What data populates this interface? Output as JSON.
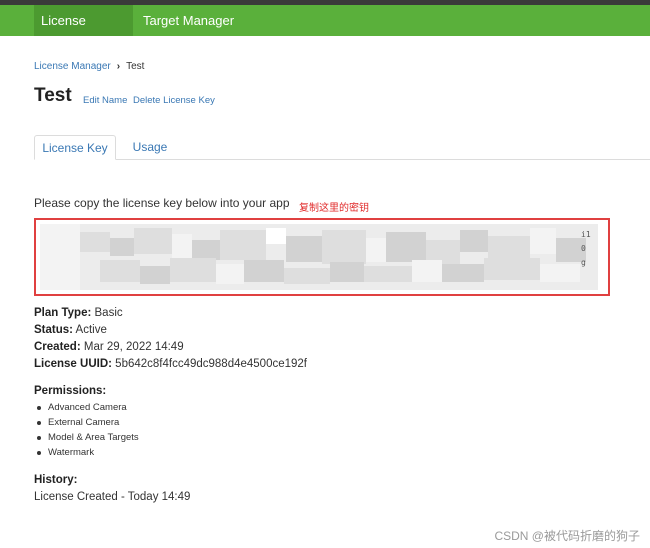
{
  "nav": {
    "items": [
      {
        "label": "License Manager",
        "active": true
      },
      {
        "label": "Target Manager",
        "active": false
      }
    ]
  },
  "breadcrumb": {
    "parent": "License Manager",
    "separator": "›",
    "current": "Test"
  },
  "page": {
    "title": "Test",
    "edit_name": "Edit Name",
    "delete_key": "Delete License Key"
  },
  "tabs": [
    {
      "label": "License Key",
      "active": true
    },
    {
      "label": "Usage",
      "active": false
    }
  ],
  "license": {
    "instructions": "Please copy the license key below into your app",
    "annotation": "复制这里的密钥",
    "key_redacted": true,
    "key_visible_edges": [
      "i1",
      "0",
      "g"
    ]
  },
  "details": {
    "plan_type_label": "Plan Type:",
    "plan_type": "Basic",
    "status_label": "Status:",
    "status": "Active",
    "created_label": "Created:",
    "created": "Mar 29, 2022 14:49",
    "uuid_label": "License UUID:",
    "uuid": "5b642c8f4fcc49dc988d4e4500ce192f"
  },
  "permissions": {
    "heading": "Permissions:",
    "items": [
      "Advanced Camera",
      "External Camera",
      "Model & Area Targets",
      "Watermark"
    ]
  },
  "history": {
    "heading": "History:",
    "entry": "License Created - Today 14:49"
  },
  "watermark": "CSDN @被代码折磨的狗子",
  "colors": {
    "nav_bg": "#5ab03b",
    "nav_active": "#4c9a30",
    "link": "#3a78b4",
    "highlight_border": "#e04040",
    "annotation": "#e02a2a"
  }
}
